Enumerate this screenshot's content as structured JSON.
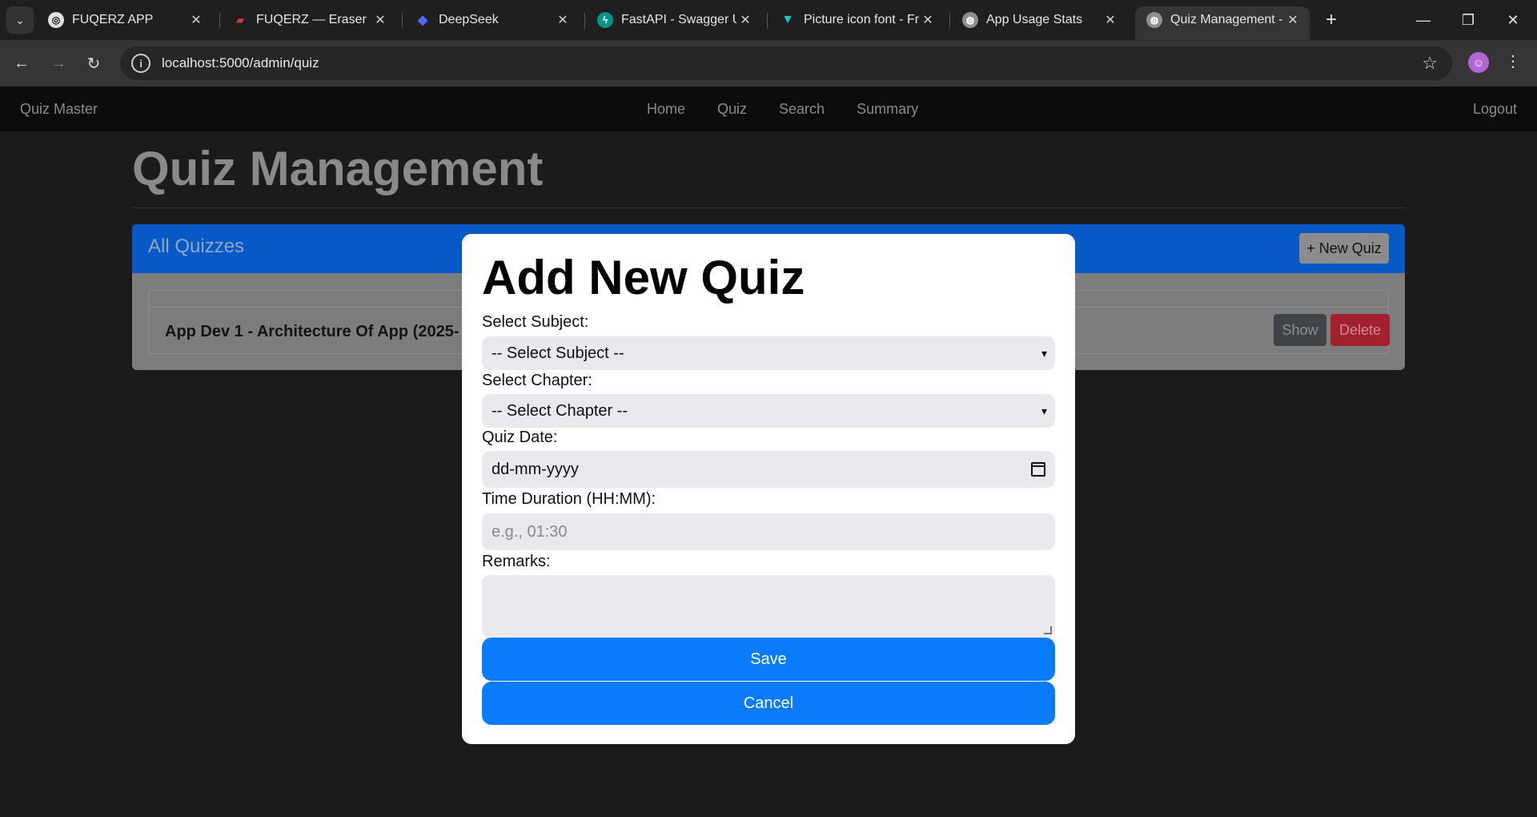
{
  "browser": {
    "tabs": [
      {
        "title": "FUQERZ APP",
        "favicon": "openai-icon",
        "color": "#e0e0e0"
      },
      {
        "title": "FUQERZ — Eraser",
        "favicon": "eraser-icon",
        "color": "#e0303a"
      },
      {
        "title": "DeepSeek",
        "favicon": "deepseek-icon",
        "color": "#4d6bfe"
      },
      {
        "title": "FastAPI - Swagger UI",
        "favicon": "fastapi-icon",
        "color": "#059486"
      },
      {
        "title": "Picture icon font - Fr",
        "favicon": "vuetify-icon",
        "color": "#1dc4c4"
      },
      {
        "title": "App Usage Stats",
        "favicon": "globe-icon",
        "color": "#9a9a9a"
      },
      {
        "title": "Quiz Management - /",
        "favicon": "globe-icon",
        "color": "#9a9a9a",
        "active": true
      }
    ],
    "url": "localhost:5000/admin/quiz"
  },
  "navbar": {
    "brand": "Quiz Master",
    "links": [
      "Home",
      "Quiz",
      "Search",
      "Summary"
    ],
    "logout": "Logout"
  },
  "page": {
    "title": "Quiz Management",
    "card_title": "All Quizzes",
    "new_quiz_button": "+ New Quiz",
    "quiz_row": {
      "name": "App Dev 1 - Architecture Of App (2025-",
      "show_button": "Show",
      "delete_button": "Delete"
    }
  },
  "modal": {
    "title": "Add New Quiz",
    "subject_label": "Select Subject:",
    "subject_value": "-- Select Subject --",
    "chapter_label": "Select Chapter:",
    "chapter_value": "-- Select Chapter --",
    "date_label": "Quiz Date:",
    "date_value": "dd-mm-yyyy",
    "duration_label": "Time Duration (HH:MM):",
    "duration_placeholder": "e.g., 01:30",
    "remarks_label": "Remarks:",
    "remarks_value": "",
    "save_button": "Save",
    "cancel_button": "Cancel"
  }
}
